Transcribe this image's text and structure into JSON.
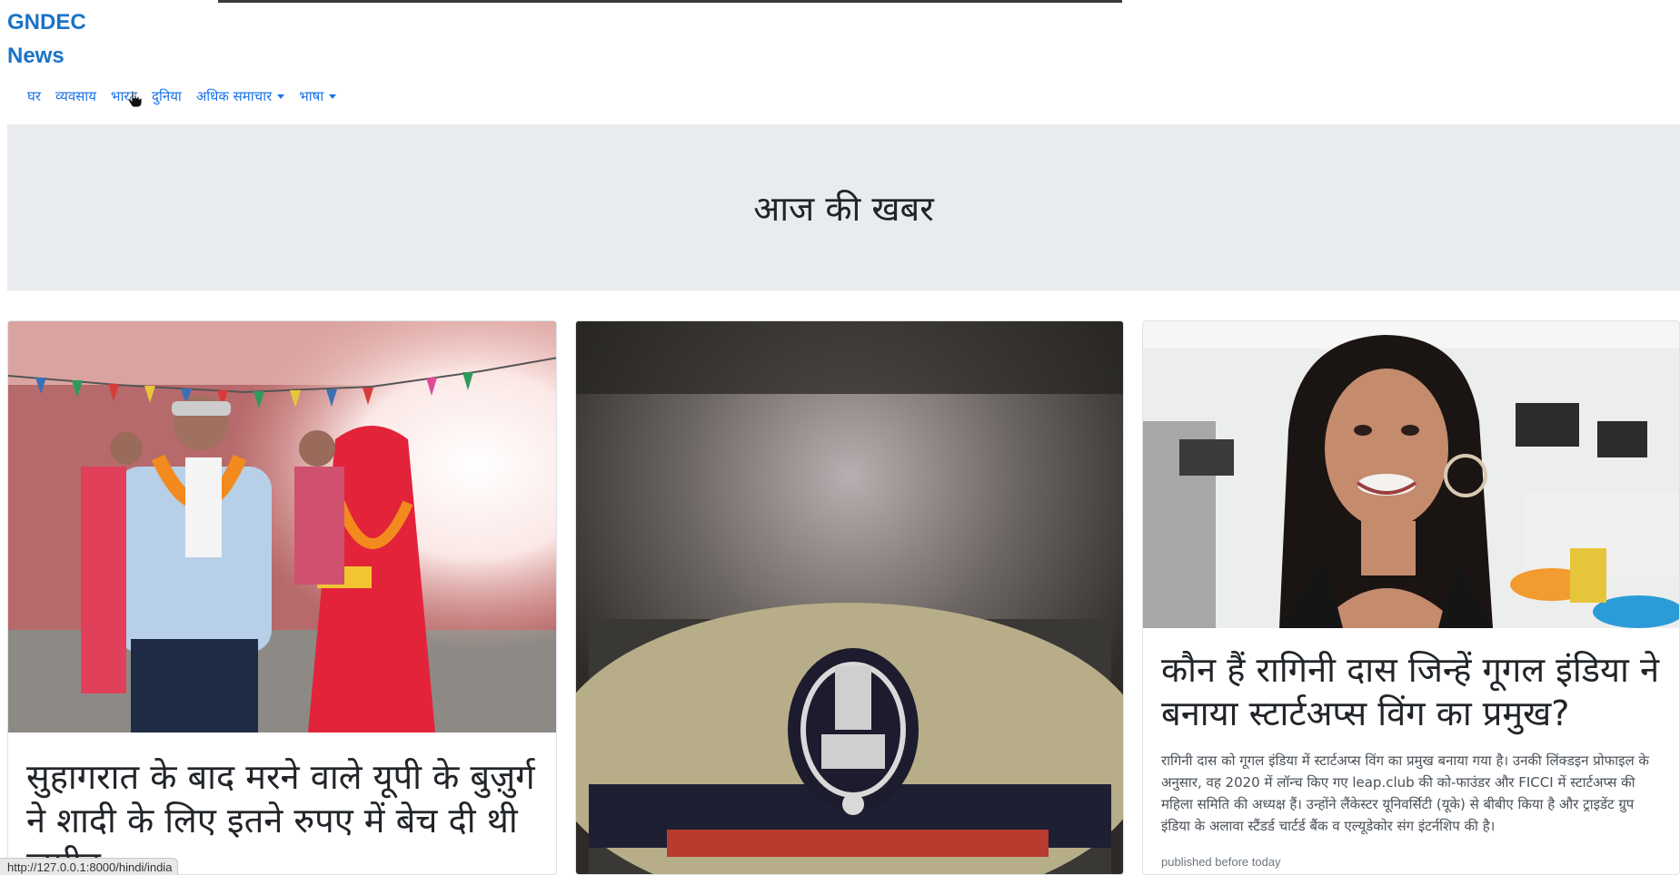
{
  "brand": "GNDEC\nNews",
  "nav": {
    "home": "घर",
    "business": "व्यवसाय",
    "india": "भारत",
    "world": "दुनिया",
    "more_news": "अधिक समाचार",
    "language": "भाषा"
  },
  "jumbotron": {
    "heading": "आज की खबर"
  },
  "cards": [
    {
      "title": "सुहागरात के बाद मरने वाले यूपी के बुज़ुर्ग ने शादी के लिए इतने रुपए में बेच दी थी ज़मीन",
      "image": "wedding-couple-photo"
    },
    {
      "image": "police-cap-photo"
    },
    {
      "title": "कौन हैं रागिनी दास जिन्हें गूगल इंडिया ने बनाया स्टार्टअप्स विंग का प्रमुख?",
      "description": "रागिनी दास को गूगल इंडिया में स्टार्टअप्स विंग का प्रमुख बनाया गया है। उनकी लिंक्डइन प्रोफाइल के अनुसार, वह 2020 में लॉन्च किए गए leap.club की को-फाउंडर और FICCI में स्टार्टअप्स की महिला समिति की अध्यक्ष हैं। उन्होंने लैंकेस्टर यूनिवर्सिटी (यूके) से बीबीए किया है और ट्राइडेंट ग्रुप इंडिया के अलावा स्टैंडर्ड चार्टर्ड बैंक व एल्यूडेकोर संग इंटर्नशिप की है।",
      "meta": "published before today",
      "image": "woman-office-portrait-photo"
    }
  ],
  "status_url": "http://127.0.0.1:8000/hindi/india",
  "colors": {
    "link": "#1a73e8",
    "jumbotron_bg": "#e9ecef",
    "brand": "#1a73c8"
  }
}
